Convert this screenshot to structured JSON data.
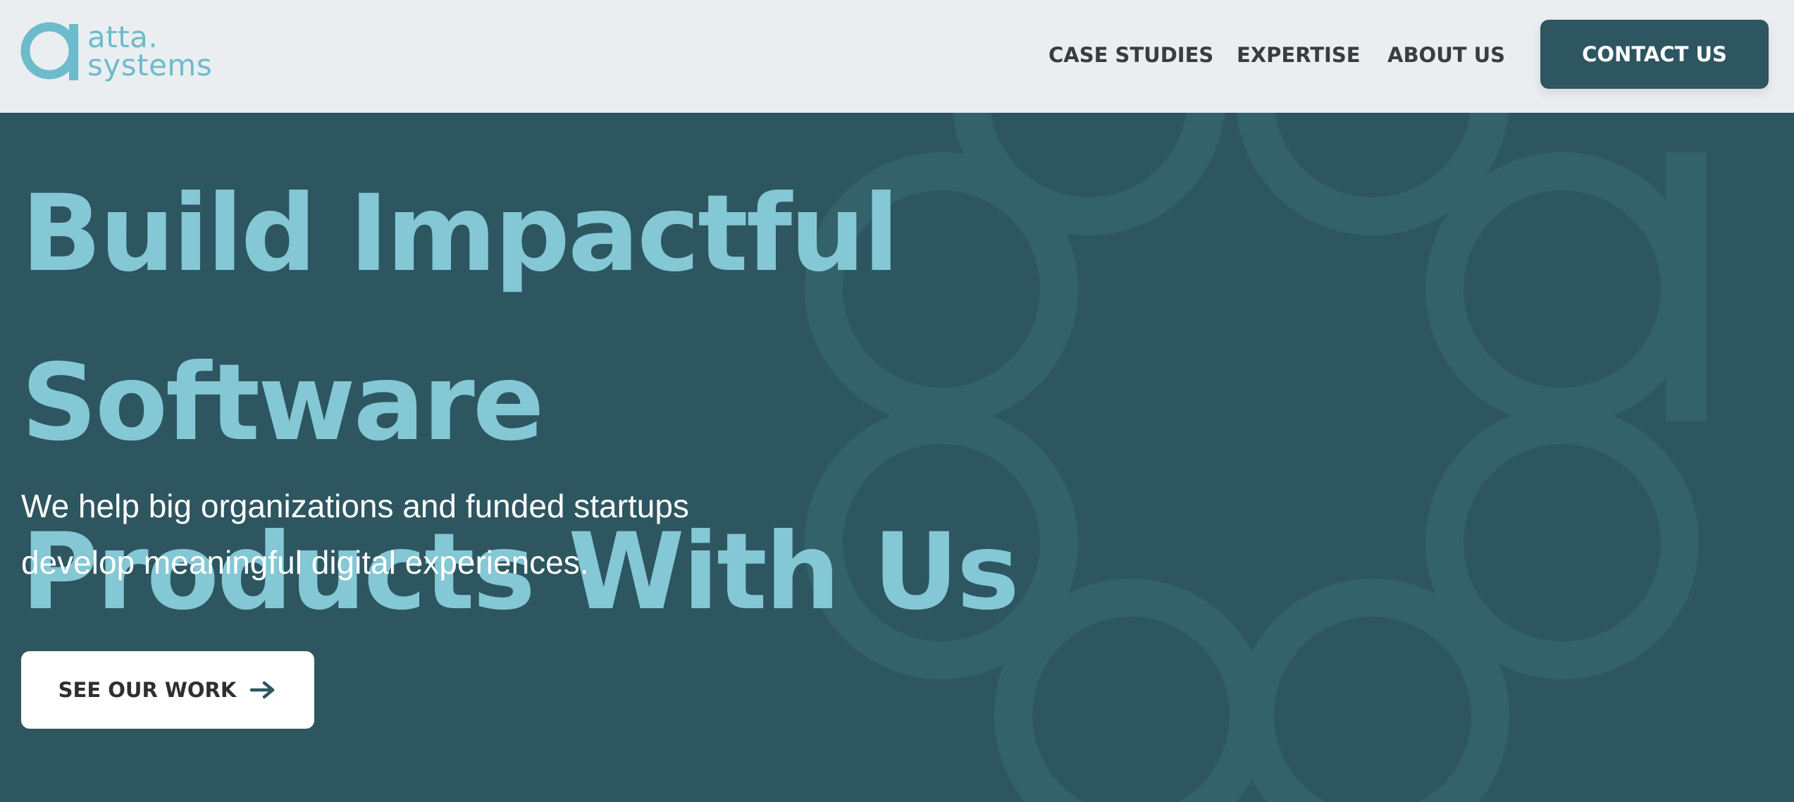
{
  "brand": {
    "name_line1": "atta.",
    "name_line2": "systems",
    "logo_icon": "letter-a-circle-icon",
    "accent_color": "#6cbccb"
  },
  "nav": {
    "links": [
      {
        "label": "CASE STUDIES"
      },
      {
        "label": "EXPERTISE"
      },
      {
        "label": "ABOUT US"
      }
    ],
    "contact_label": "CONTACT US"
  },
  "hero": {
    "title_line1": "Build Impactful Software",
    "title_line2": "Products With Us",
    "subtitle_line1": "We help big organizations and funded startups",
    "subtitle_line2": "develop meaningful digital experiences.",
    "cta_label": "SEE OUR WORK",
    "cta_icon": "arrow-right-icon",
    "background_color": "#2d5660",
    "title_color": "#84c7d5",
    "decor_icon": "atta-ring-pattern"
  }
}
